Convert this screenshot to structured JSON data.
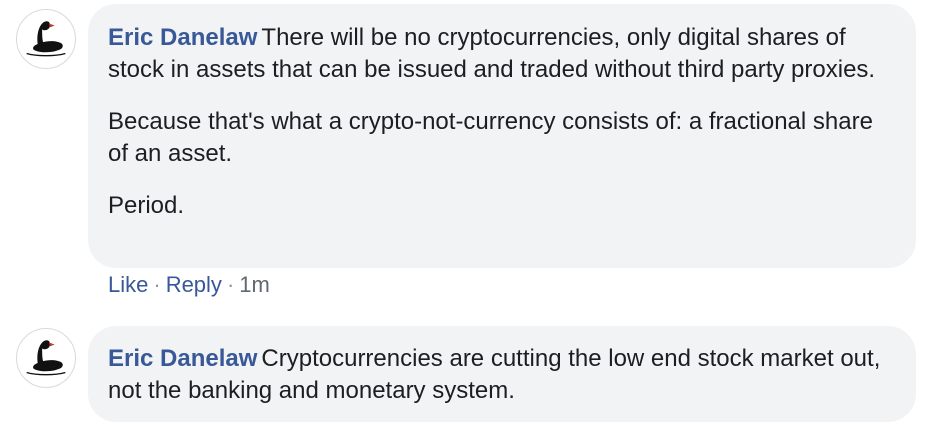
{
  "comments": [
    {
      "author": "Eric Danelaw",
      "avatar_icon": "black-swan-icon",
      "paragraphs": [
        "There will be no cryptocurrencies, only digital shares of stock in assets that can be issued and traded without third party proxies.",
        "Because that's what a crypto-not-currency consists of: a fractional share of an asset.",
        "Period."
      ],
      "actions": {
        "like": "Like",
        "reply": "Reply",
        "separator": "·",
        "time": "1m"
      }
    },
    {
      "author": "Eric Danelaw",
      "avatar_icon": "black-swan-icon",
      "paragraphs": [
        "Cryptocurrencies are cutting the low end stock market out, not the banking and monetary system."
      ]
    }
  ],
  "colors": {
    "author_link": "#385898",
    "bubble_background": "#f2f3f5",
    "meta_text": "#606770"
  }
}
